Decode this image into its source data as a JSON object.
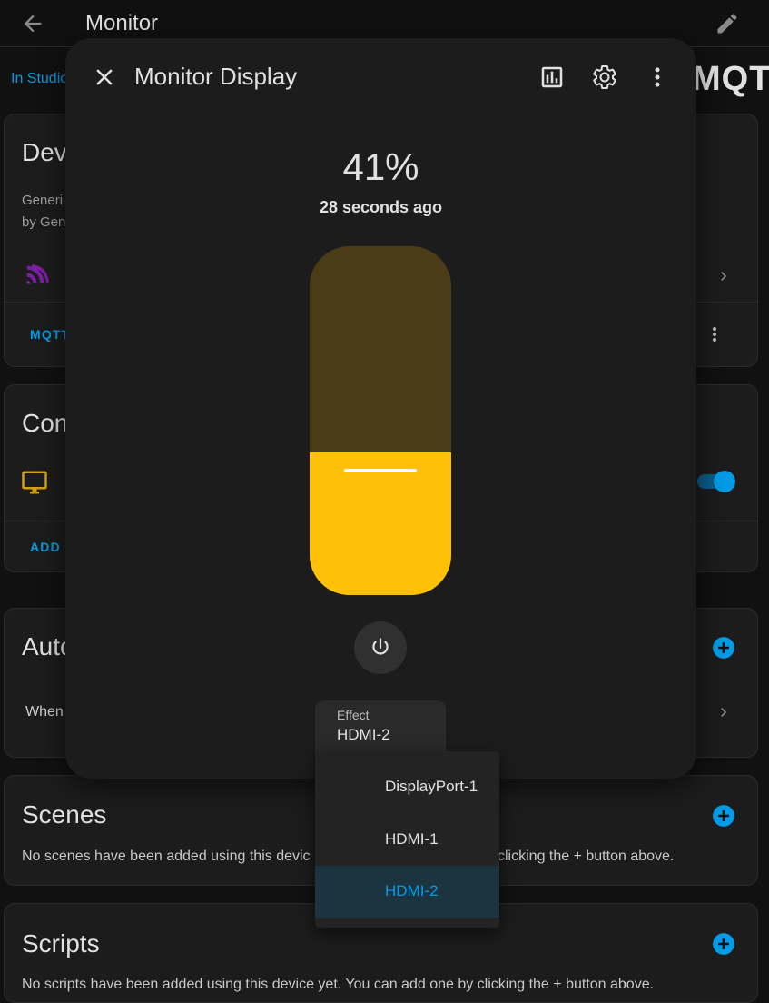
{
  "page": {
    "title": "Monitor",
    "area_link": "In Studio",
    "integration_logo": "MQTT"
  },
  "cards": {
    "device_info": {
      "title": "Dev",
      "model": "Generi",
      "manufacturer": "by Gen",
      "link_label": "MQTT"
    },
    "controls": {
      "title": "Con",
      "add_label": "ADD",
      "toggle_state": "on"
    },
    "automations": {
      "title": "Auto",
      "item_label": "When"
    },
    "scenes": {
      "title": "Scenes",
      "empty_left": "No scenes have been added using this devic",
      "empty_right": "clicking the + button above."
    },
    "scripts": {
      "title": "Scripts",
      "empty": "No scripts have been added using this device yet. You can add one by clicking the + button above."
    }
  },
  "dialog": {
    "title": "Monitor Display",
    "brightness_text": "41%",
    "brightness_value": 41,
    "last_changed": "28 seconds ago",
    "effect_label": "Effect",
    "effect_value": "HDMI-2",
    "accent_color": "#ffc107",
    "track_color": "#4a3c16"
  },
  "effect_menu": {
    "options": [
      "DisplayPort-1",
      "HDMI-1",
      "HDMI-2"
    ],
    "selected": "HDMI-2"
  },
  "colors": {
    "primary": "#039be5",
    "background": "#111111",
    "card": "#1c1c1c",
    "light_icon": "#d4a017",
    "mqtt_icon": "#7b1fa2"
  }
}
